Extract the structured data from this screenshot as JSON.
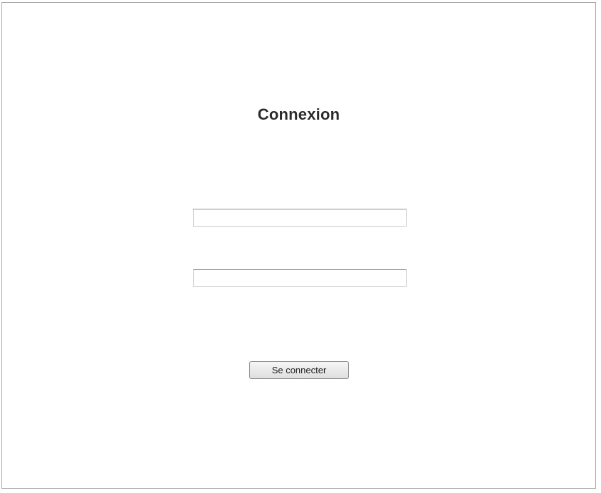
{
  "login_form": {
    "title": "Connexion",
    "username_field": {
      "value": "",
      "placeholder": ""
    },
    "password_field": {
      "value": "",
      "placeholder": ""
    },
    "submit_label": "Se connecter"
  }
}
